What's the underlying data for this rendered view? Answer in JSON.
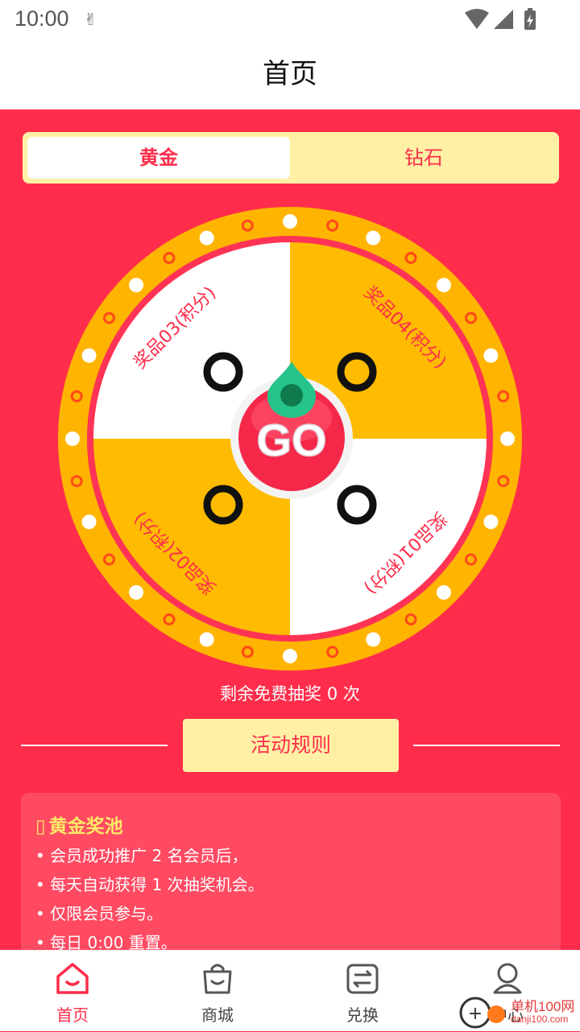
{
  "status": {
    "time": "10:00",
    "notif": "✌"
  },
  "header": {
    "title": "首页"
  },
  "tabs": [
    {
      "label": "黄金"
    },
    {
      "label": "钻石"
    }
  ],
  "wheel": {
    "prizes": [
      "奖品01(积分)",
      "奖品02(积分)",
      "奖品03(积分)",
      "奖品04(积分)"
    ],
    "go_label": "GO",
    "colors": {
      "ring": "#ffb400",
      "white": "#ffffff",
      "gold": "#ffbb00",
      "text": "#ff2d4b",
      "go": "#f5284a",
      "pointer": "#26c48a"
    }
  },
  "remain_text": "剩余免费抽奖 0 次",
  "rules_button": "活动规则",
  "pool": {
    "title_mark": "▯",
    "title": "黄金奖池",
    "lines": [
      "• 会员成功推广 2 名会员后，",
      "• 每天自动获得 1 次抽奖机会。",
      "• 仅限会员参与。",
      "• 每日 0:00 重置。"
    ]
  },
  "nav": [
    {
      "label": "首页",
      "icon": "home-icon",
      "active": true
    },
    {
      "label": "商城",
      "icon": "shopping-bag-icon",
      "active": false
    },
    {
      "label": "兑换",
      "icon": "exchange-icon",
      "active": false
    },
    {
      "label": "中心",
      "icon": "user-icon",
      "active": false
    }
  ],
  "watermark": {
    "text": "单机100网",
    "sub": "danji100.com"
  }
}
